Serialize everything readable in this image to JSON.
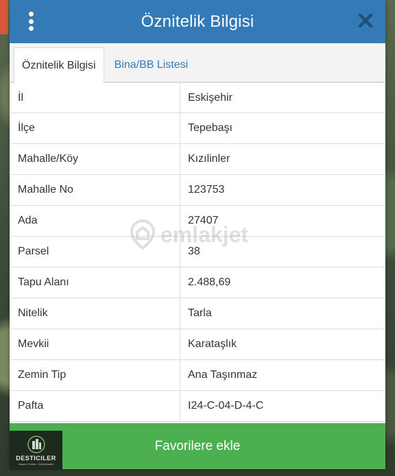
{
  "header": {
    "title": "Öznitelik Bilgisi"
  },
  "tabs": [
    {
      "label": "Öznitelik Bilgisi",
      "active": true
    },
    {
      "label": "Bina/BB Listesi",
      "active": false
    }
  ],
  "attributes": [
    {
      "key": "İl",
      "value": "Eskişehir"
    },
    {
      "key": "İlçe",
      "value": "Tepebaşı"
    },
    {
      "key": "Mahalle/Köy",
      "value": "Kızılinler"
    },
    {
      "key": "Mahalle No",
      "value": "123753"
    },
    {
      "key": "Ada",
      "value": "27407"
    },
    {
      "key": "Parsel",
      "value": "38"
    },
    {
      "key": "Tapu Alanı",
      "value": "2.488,69"
    },
    {
      "key": "Nitelik",
      "value": "Tarla"
    },
    {
      "key": "Mevkii",
      "value": "Karataşlık"
    },
    {
      "key": "Zemin Tip",
      "value": "Ana Taşınmaz"
    },
    {
      "key": "Pafta",
      "value": "I24-C-04-D-4-C"
    }
  ],
  "footer": {
    "button_label": "Favorilere ekle"
  },
  "watermark": {
    "text": "emlakjet"
  },
  "logo": {
    "name": "DESTICILER",
    "tagline": "İnşaat • Emlak • Danışmanlık"
  },
  "colors": {
    "header": "#337ab7",
    "tab_link": "#337ab7",
    "button": "#4caf50",
    "close_icon": "#1f4f7a"
  },
  "icons": [
    "menu-dots-icon",
    "close-icon",
    "location-pin-icon",
    "building-logo-icon"
  ]
}
